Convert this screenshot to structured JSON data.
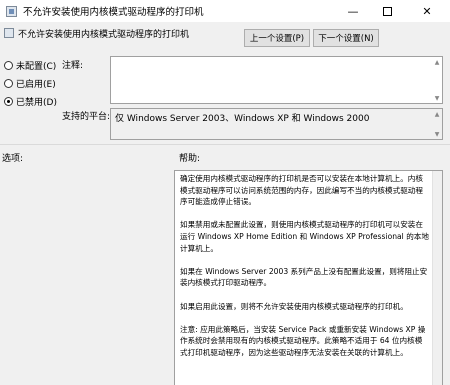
{
  "window": {
    "title": "不允许安装使用内核模式驱动程序的打印机",
    "minimize_glyph": "—",
    "close_glyph": "✕"
  },
  "header": {
    "title": "不允许安装使用内核模式驱动程序的打印机"
  },
  "nav": {
    "prev_label": "上一个设置(P)",
    "next_label": "下一个设置(N)"
  },
  "state": {
    "options": [
      {
        "label": "未配置(C)",
        "checked": false
      },
      {
        "label": "已启用(E)",
        "checked": false
      },
      {
        "label": "已禁用(D)",
        "checked": true
      }
    ]
  },
  "comment": {
    "label": "注释:",
    "value": ""
  },
  "platform": {
    "label": "支持的平台:",
    "value": "仅 Windows Server 2003、Windows XP 和 Windows 2000"
  },
  "options_section": {
    "label": "选项:"
  },
  "help_section": {
    "label": "帮助:",
    "paragraphs": [
      "确定使用内核模式驱动程序的打印机是否可以安装在本地计算机上。内核模式驱动程序可以访问系统范围的内存，因此编写不当的内核模式驱动程序可能造成停止错误。",
      "如果禁用或未配置此设置，则使用内核模式驱动程序的打印机可以安装在运行 Windows XP Home Edition 和 Windows XP Professional 的本地计算机上。",
      "如果在 Windows Server 2003 系列产品上没有配置此设置，则将阻止安装内核模式打印驱动程序。",
      "如果启用此设置，则将不允许安装使用内核模式驱动程序的打印机。",
      "注意: 应用此策略后，当安装 Service Pack 或重新安装 Windows XP 操作系统时会禁用现有的内核模式驱动程序。此策略不适用于 64 位内核模式打印机驱动程序，因为这些驱动程序无法安装在关联的计算机上。"
    ]
  },
  "colors": {
    "window_bg": "#f0f0f0",
    "field_bg": "#ffffff",
    "border": "#a0a0a0"
  }
}
